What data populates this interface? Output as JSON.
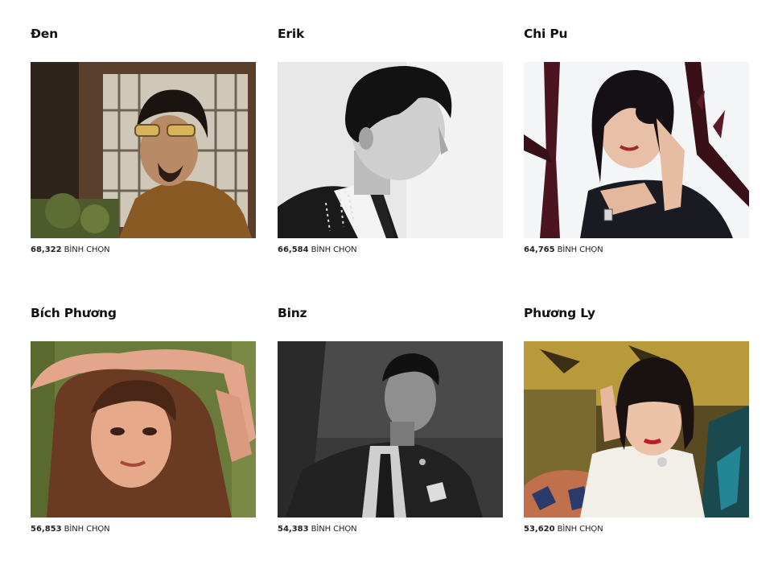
{
  "nominees": [
    {
      "name": "Đen",
      "votes": "68,322",
      "unit": "BÌNH CHỌN",
      "photo": "man-with-glasses-photo",
      "tone": "sepia"
    },
    {
      "name": "Erik",
      "votes": "66,584",
      "unit": "BÌNH CHỌN",
      "photo": "profile-portrait-photo",
      "tone": "mono-light"
    },
    {
      "name": "Chi Pu",
      "votes": "64,765",
      "unit": "BÌNH CHỌN",
      "photo": "fashion-portrait-photo",
      "tone": "color"
    },
    {
      "name": "Bích Phương",
      "votes": "56,853",
      "unit": "BÌNH CHỌN",
      "photo": "warm-portrait-photo",
      "tone": "warm"
    },
    {
      "name": "Binz",
      "votes": "54,383",
      "unit": "BÌNH CHỌN",
      "photo": "suit-portrait-photo",
      "tone": "mono-dark"
    },
    {
      "name": "Phương Ly",
      "votes": "53,620",
      "unit": "BÌNH CHỌN",
      "photo": "night-portrait-photo",
      "tone": "night"
    }
  ]
}
